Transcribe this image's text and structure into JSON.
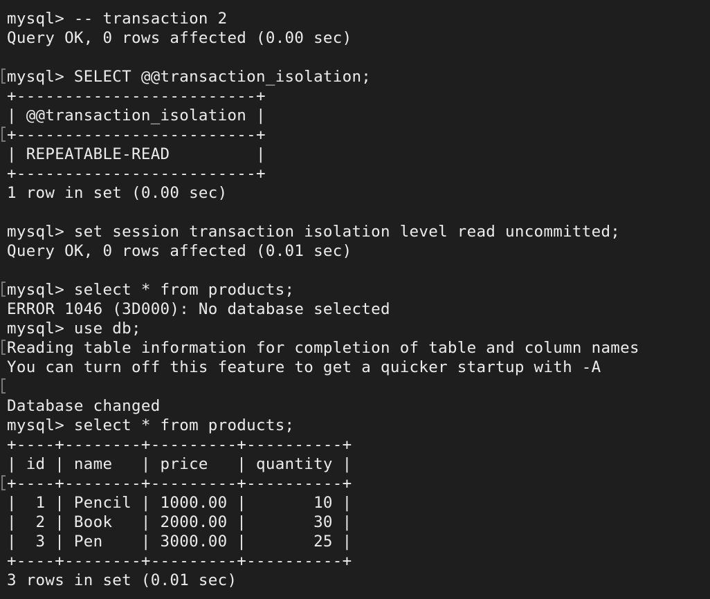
{
  "terminal": {
    "lines": [
      {
        "text": "mysql> -- transaction 2",
        "marked": false
      },
      {
        "text": "Query OK, 0 rows affected (0.00 sec)",
        "marked": false
      },
      {
        "text": "",
        "marked": false
      },
      {
        "text": "mysql> SELECT @@transaction_isolation;",
        "marked": true
      },
      {
        "text": "+-------------------------+",
        "marked": false
      },
      {
        "text": "| @@transaction_isolation |",
        "marked": false
      },
      {
        "text": "+-------------------------+",
        "marked": true
      },
      {
        "text": "| REPEATABLE-READ         |",
        "marked": false
      },
      {
        "text": "+-------------------------+",
        "marked": false
      },
      {
        "text": "1 row in set (0.00 sec)",
        "marked": false
      },
      {
        "text": "",
        "marked": false
      },
      {
        "text": "mysql> set session transaction isolation level read uncommitted;",
        "marked": false
      },
      {
        "text": "Query OK, 0 rows affected (0.01 sec)",
        "marked": false
      },
      {
        "text": "",
        "marked": false
      },
      {
        "text": "mysql> select * from products;",
        "marked": true
      },
      {
        "text": "ERROR 1046 (3D000): No database selected",
        "marked": false
      },
      {
        "text": "mysql> use db;",
        "marked": false
      },
      {
        "text": "Reading table information for completion of table and column names",
        "marked": true
      },
      {
        "text": "You can turn off this feature to get a quicker startup with -A",
        "marked": false
      },
      {
        "text": "",
        "marked": true
      },
      {
        "text": "Database changed",
        "marked": false
      },
      {
        "text": "mysql> select * from products;",
        "marked": false
      },
      {
        "text": "+----+--------+---------+----------+",
        "marked": false
      },
      {
        "text": "| id | name   | price   | quantity |",
        "marked": false
      },
      {
        "text": "+----+--------+---------+----------+",
        "marked": true
      },
      {
        "text": "|  1 | Pencil | 1000.00 |       10 |",
        "marked": false
      },
      {
        "text": "|  2 | Book   | 2000.00 |       30 |",
        "marked": false
      },
      {
        "text": "|  3 | Pen    | 3000.00 |       25 |",
        "marked": false
      },
      {
        "text": "+----+--------+---------+----------+",
        "marked": false
      },
      {
        "text": "3 rows in set (0.01 sec)",
        "marked": false
      }
    ]
  }
}
